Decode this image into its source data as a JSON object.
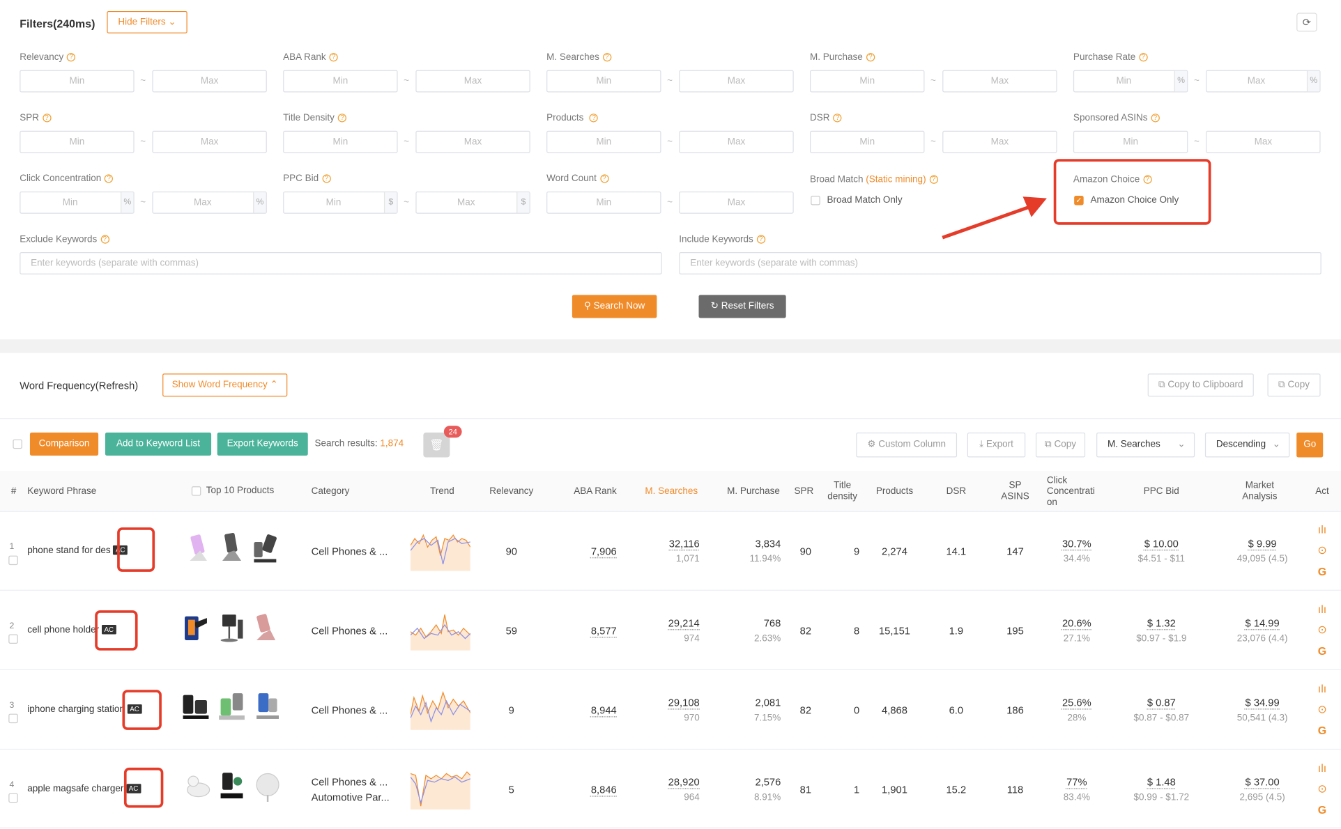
{
  "filters": {
    "title": "Filters(240ms)",
    "hide_btn": "Hide Filters",
    "min_ph": "Min",
    "max_ph": "Max",
    "dash": "~",
    "pct": "%",
    "usd": "$",
    "relevancy": "Relevancy",
    "aba_rank": "ABA Rank",
    "m_searches": "M. Searches",
    "m_purchase": "M. Purchase",
    "purchase_rate": "Purchase Rate",
    "spr": "SPR",
    "title_density": "Title Density",
    "products": "Products",
    "dsr": "DSR",
    "sponsored_asins": "Sponsored ASINs",
    "click_concentration": "Click Concentration",
    "ppc_bid": "PPC Bid",
    "word_count": "Word Count",
    "broad_match": "Broad Match",
    "static_mining": "(Static mining)",
    "broad_match_only": "Broad Match Only",
    "amazon_choice": "Amazon Choice",
    "amazon_choice_only": "Amazon Choice Only",
    "exclude_keywords": "Exclude Keywords",
    "include_keywords": "Include Keywords",
    "keywords_ph": "Enter keywords (separate with commas)",
    "search_now": "Search Now",
    "reset_filters": "Reset Filters"
  },
  "word_freq": {
    "title": "Word Frequency(Refresh)",
    "show_btn": "Show Word Frequency",
    "copy_clipboard": "Copy to Clipboard",
    "copy": "Copy"
  },
  "toolbar": {
    "comparison": "Comparison",
    "add_keyword_list": "Add to Keyword List",
    "export_keywords": "Export Keywords",
    "results_label": "Search results:",
    "results_count": "1,874",
    "trash_badge": "24",
    "custom_column": "Custom Column",
    "export": "Export",
    "copy": "Copy",
    "sort_field": "M. Searches",
    "sort_order": "Descending",
    "go": "Go"
  },
  "table": {
    "headers": {
      "num": "#",
      "keyword": "Keyword Phrase",
      "top10": "Top 10 Products",
      "category": "Category",
      "trend": "Trend",
      "relevancy": "Relevancy",
      "aba_rank": "ABA Rank",
      "m_searches": "M. Searches",
      "m_purchase": "M. Purchase",
      "spr": "SPR",
      "title_density": "Title density",
      "products": "Products",
      "dsr": "DSR",
      "sp_asins": "SP ASINS",
      "click_conc": "Click Concentrati on",
      "ppc_bid": "PPC Bid",
      "market": "Market Analysis",
      "act": "Act"
    },
    "ac_badge": "AC",
    "rows": [
      {
        "num": "1",
        "keyword": "phone stand for des",
        "category": "Cell Phones & ...",
        "category2": "",
        "relevancy": "90",
        "aba": "7,906",
        "searches": "32,116",
        "searches_sub": "1,071",
        "purchase": "3,834",
        "purchase_sub": "11.94%",
        "spr": "90",
        "title_density": "9",
        "products": "2,274",
        "dsr": "14.1",
        "sp_asins": "147",
        "click": "30.7%",
        "click_sub": "34.4%",
        "ppc": "$ 10.00",
        "ppc_sub": "$4.51 - $11",
        "market": "$ 9.99",
        "market_sub": "49,095 (4.5)"
      },
      {
        "num": "2",
        "keyword": "cell phone holder",
        "category": "Cell Phones & ...",
        "category2": "",
        "relevancy": "59",
        "aba": "8,577",
        "searches": "29,214",
        "searches_sub": "974",
        "purchase": "768",
        "purchase_sub": "2.63%",
        "spr": "82",
        "title_density": "8",
        "products": "15,151",
        "dsr": "1.9",
        "sp_asins": "195",
        "click": "20.6%",
        "click_sub": "27.1%",
        "ppc": "$ 1.32",
        "ppc_sub": "$0.97 - $1.9",
        "market": "$ 14.99",
        "market_sub": "23,076 (4.4)"
      },
      {
        "num": "3",
        "keyword": "iphone charging station",
        "category": "Cell Phones & ...",
        "category2": "",
        "relevancy": "9",
        "aba": "8,944",
        "searches": "29,108",
        "searches_sub": "970",
        "purchase": "2,081",
        "purchase_sub": "7.15%",
        "spr": "82",
        "title_density": "0",
        "products": "4,868",
        "dsr": "6.0",
        "sp_asins": "186",
        "click": "25.6%",
        "click_sub": "28%",
        "ppc": "$ 0.87",
        "ppc_sub": "$0.87 - $0.87",
        "market": "$ 34.99",
        "market_sub": "50,541 (4.3)"
      },
      {
        "num": "4",
        "keyword": "apple magsafe charger",
        "category": "Cell Phones & ...",
        "category2": "Automotive Par...",
        "relevancy": "5",
        "aba": "8,846",
        "searches": "28,920",
        "searches_sub": "964",
        "purchase": "2,576",
        "purchase_sub": "8.91%",
        "spr": "81",
        "title_density": "1",
        "products": "1,901",
        "dsr": "15.2",
        "sp_asins": "118",
        "click": "77%",
        "click_sub": "83.4%",
        "ppc": "$ 1.48",
        "ppc_sub": "$0.99 - $1.72",
        "market": "$ 37.00",
        "market_sub": "2,695 (4.5)"
      }
    ]
  },
  "colors": {
    "accent": "#f08b2a",
    "green": "#4bb39a",
    "annotation": "#e53c2a"
  }
}
